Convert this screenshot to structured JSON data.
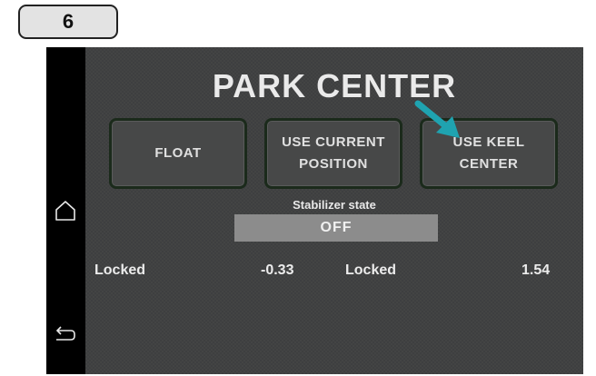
{
  "step_badge": "6",
  "title": "PARK CENTER",
  "buttons": {
    "float": "FLOAT",
    "use_current_position": [
      "USE CURRENT",
      "POSITION"
    ],
    "use_keel_center": [
      "USE KEEL",
      "CENTER"
    ]
  },
  "stabilizer": {
    "label": "Stabilizer state",
    "value": "OFF"
  },
  "readouts": {
    "left": {
      "status": "Locked",
      "value": "-0.33"
    },
    "right": {
      "status": "Locked",
      "value": "1.54"
    }
  },
  "nav": {
    "home_icon": "home-icon",
    "back_icon": "back-icon"
  },
  "colors": {
    "arrow": "#1fa3b0",
    "button_border": "#1b2a1b",
    "state_box": "#8c8c8c"
  }
}
